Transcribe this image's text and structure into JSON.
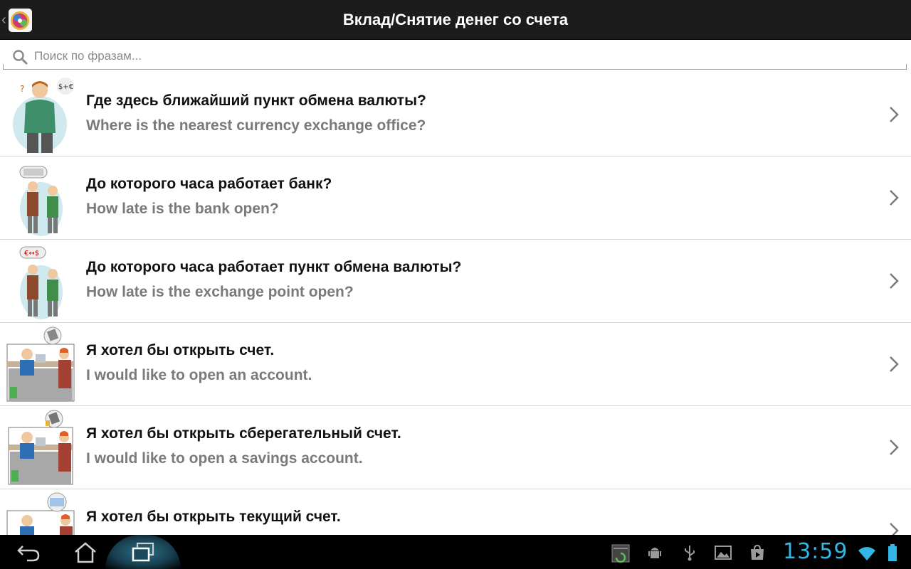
{
  "header": {
    "title": "Вклад/Снятие денег со счета",
    "app_icon": "app-logo-icon",
    "back_icon": "back-chevron-icon"
  },
  "search": {
    "placeholder": "Поиск по фразам...",
    "value": "",
    "icon": "search-icon"
  },
  "phrases": [
    {
      "ru": "Где здесь ближайший пункт обмена валюты?",
      "en": "Where is the nearest currency exchange office?",
      "illustration": "man-confused-currency-illustration"
    },
    {
      "ru": "До которого часа работает банк?",
      "en": "How late is the bank open?",
      "illustration": "two-people-bank-clock-illustration"
    },
    {
      "ru": "До которого часа работает пункт обмена валюты?",
      "en": "How late is the exchange point open?",
      "illustration": "two-people-exchange-illustration"
    },
    {
      "ru": "Я хотел бы открыть счет.",
      "en": "I would like to open an account.",
      "illustration": "bank-counter-account-illustration"
    },
    {
      "ru": "Я хотел бы открыть сберегательный счет.",
      "en": "I would like to open a savings account.",
      "illustration": "bank-counter-savings-illustration"
    },
    {
      "ru": "Я хотел бы открыть текущий счет.",
      "en": "",
      "illustration": "bank-counter-checking-illustration"
    }
  ],
  "system_bar": {
    "clock": "13:59",
    "colors": {
      "clock": "#33b5e5",
      "bar": "#000000"
    },
    "icons": [
      "back-icon",
      "home-icon",
      "recent-apps-icon",
      "screenshot-icon",
      "android-debug-icon",
      "usb-icon",
      "gallery-icon",
      "store-icon",
      "wifi-icon",
      "battery-icon"
    ]
  }
}
